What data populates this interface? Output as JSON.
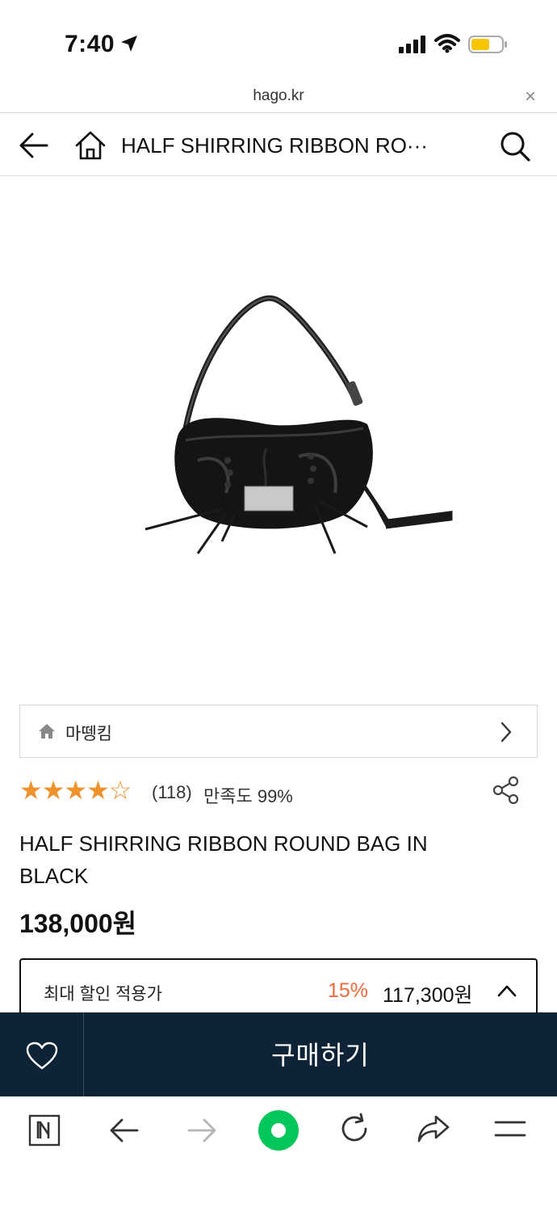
{
  "status_bar": {
    "time": "7:40"
  },
  "url_bar": {
    "domain": "hago.kr",
    "close_glyph": "×"
  },
  "header": {
    "title": "HALF SHIRRING RIBBON RO···"
  },
  "product": {
    "image_alt": "black shirred ribbon round shoulder bag",
    "brand": "마뗑킴",
    "rating": 4.5,
    "stars_filled": "★★★★",
    "stars_empty": "☆",
    "review_count": "(118)",
    "satisfaction": "만족도 99%",
    "title": "HALF SHIRRING RIBBON ROUND BAG IN BLACK",
    "price": "138,000원"
  },
  "discount": {
    "label": "최대 할인 적용가",
    "rate": "15%",
    "price": "117,300원"
  },
  "buy_bar": {
    "buy_label": "구매하기"
  },
  "colors": {
    "accent_orange": "#ef6a3a",
    "star_color": "#f0922b",
    "buy_bar_bg": "#0f2337",
    "naver_green": "#03c75a",
    "battery_yellow": "#f7c600"
  },
  "icons": {
    "status": [
      "location-arrow-icon",
      "signal-icon",
      "wifi-icon",
      "battery-icon"
    ],
    "header": [
      "back-arrow-icon",
      "home-icon",
      "search-icon"
    ],
    "toolbar": [
      "naver-n-icon",
      "back-icon",
      "forward-icon",
      "green-dot-icon",
      "refresh-icon",
      "share-arrow-icon",
      "menu-icon"
    ]
  }
}
